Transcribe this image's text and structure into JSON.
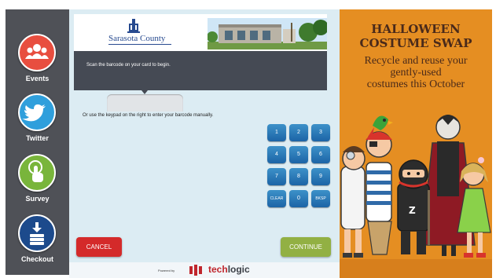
{
  "sidebar": {
    "items": [
      {
        "label": "Events",
        "icon": "people-icon",
        "color": "#e84e3f"
      },
      {
        "label": "Twitter",
        "icon": "twitter-bird-icon",
        "color": "#2f9fdc"
      },
      {
        "label": "Survey",
        "icon": "touch-hand-icon",
        "color": "#79b53b"
      },
      {
        "label": "Checkout",
        "icon": "book-stack-icon",
        "color": "#1c4a8c"
      }
    ]
  },
  "header": {
    "logo_text": "Sarasota County"
  },
  "scan": {
    "instruction": "Scan the barcode on your card to begin.",
    "barcode_value": "",
    "manual_instruction": "Or use the keypad on the right to enter your barcode manually."
  },
  "keypad": {
    "keys": [
      "1",
      "2",
      "3",
      "4",
      "5",
      "6",
      "7",
      "8",
      "9",
      "CLEAR",
      "0",
      "BKSP"
    ]
  },
  "actions": {
    "cancel": "CANCEL",
    "continue": "CONTINUE"
  },
  "footer": {
    "powered_by": "Powered by",
    "brand_a": "tech",
    "brand_b": "logic"
  },
  "ad": {
    "title_line1": "HALLOWEEN",
    "title_line2": "COSTUME SWAP",
    "sub_line1": "Recycle and reuse your",
    "sub_line2": "gently-used",
    "sub_line3": "costumes this October"
  },
  "colors": {
    "cancel": "#d42a2a",
    "continue": "#92b043",
    "key": "#1c64a6",
    "ad_background": "#e58e22",
    "rail": "#4f5157"
  }
}
